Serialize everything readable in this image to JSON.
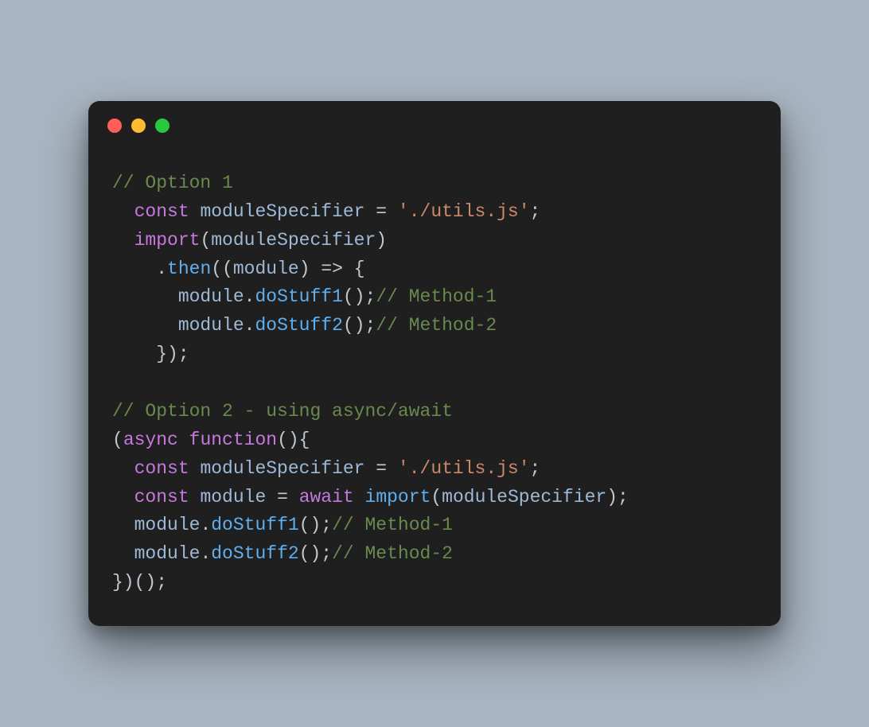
{
  "window": {
    "traffic_lights": {
      "red": "#ff5f57",
      "yellow": "#febc2e",
      "green": "#28c840"
    }
  },
  "code": {
    "lines": [
      {
        "kind": "comment",
        "text": "// Option 1"
      },
      {
        "kind": "decl",
        "indent": "  ",
        "kw": "const",
        "name": "moduleSpecifier",
        "eq": " = ",
        "str": "'./utils.js'",
        "tail": ";"
      },
      {
        "kind": "importcall",
        "indent": "  ",
        "kw": "import",
        "open": "(",
        "arg": "moduleSpecifier",
        "close": ")"
      },
      {
        "kind": "then",
        "indent": "    ",
        "dot": ".",
        "fn": "then",
        "open": "((",
        "param": "module",
        "close": ")",
        "arrow": " => ",
        "brace": "{"
      },
      {
        "kind": "call",
        "indent": "      ",
        "obj": "module",
        "dot": ".",
        "fn": "doStuff1",
        "parens": "();",
        "comment": "// Method-1"
      },
      {
        "kind": "call",
        "indent": "      ",
        "obj": "module",
        "dot": ".",
        "fn": "doStuff2",
        "parens": "();",
        "comment": "// Method-2"
      },
      {
        "kind": "punct",
        "indent": "    ",
        "text": "});"
      },
      {
        "kind": "blank",
        "text": ""
      },
      {
        "kind": "comment",
        "text": "// Option 2 - using async/await"
      },
      {
        "kind": "asyncfn",
        "open": "(",
        "kw1": "async",
        "sp": " ",
        "kw2": "function",
        "parens": "(){"
      },
      {
        "kind": "decl",
        "indent": "  ",
        "kw": "const",
        "name": "moduleSpecifier",
        "eq": " = ",
        "str": "'./utils.js'",
        "tail": ";"
      },
      {
        "kind": "awaitimp",
        "indent": "  ",
        "kw": "const",
        "name": "module",
        "eq": " = ",
        "kw2": "await",
        "sp": " ",
        "fn": "import",
        "open": "(",
        "arg": "moduleSpecifier",
        "close": ");"
      },
      {
        "kind": "call",
        "indent": "  ",
        "obj": "module",
        "dot": ".",
        "fn": "doStuff1",
        "parens": "();",
        "comment": "// Method-1"
      },
      {
        "kind": "call",
        "indent": "  ",
        "obj": "module",
        "dot": ".",
        "fn": "doStuff2",
        "parens": "();",
        "comment": "// Method-2"
      },
      {
        "kind": "punct",
        "indent": "",
        "text": "})();"
      }
    ]
  }
}
